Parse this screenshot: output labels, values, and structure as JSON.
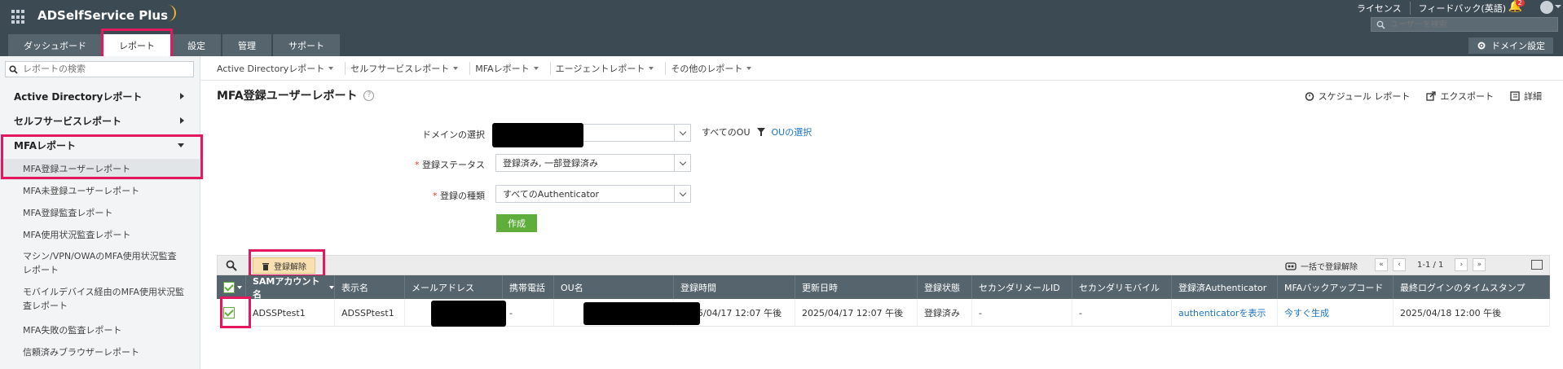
{
  "header": {
    "brand": "ADSelfService Plus",
    "links": [
      "ライセンス",
      "フィードバック(英語)"
    ],
    "notification_count": "2",
    "user_search_placeholder": "ユーザーを検索",
    "tabs": [
      "ダッシュボード",
      "レポート",
      "設定",
      "管理",
      "サポート"
    ],
    "active_tab": "レポート",
    "domain_settings": "ドメイン設定"
  },
  "sidebar": {
    "search_placeholder": "レポートの検索",
    "categories": [
      "Active Directoryレポート",
      "セルフサービスレポート",
      "MFAレポート"
    ],
    "mfa_items": [
      "MFA登録ユーザーレポート",
      "MFA未登録ユーザーレポート",
      "MFA登録監査レポート",
      "MFA使用状況監査レポート",
      "マシン/VPN/OWAのMFA使用状況監査レポート",
      "モバイルデバイス経由のMFA使用状況監査レポート",
      "MFA失敗の監査レポート",
      "信頼済みブラウザーレポート"
    ]
  },
  "report_nav": [
    "Active Directoryレポート",
    "セルフサービスレポート",
    "MFAレポート",
    "エージェントレポート",
    "その他のレポート"
  ],
  "page": {
    "title": "MFA登録ユーザーレポート",
    "actions": [
      "スケジュール レポート",
      "エクスポート",
      "詳細"
    ]
  },
  "form": {
    "domain_label": "ドメインの選択",
    "ou_all": "すべてのOU",
    "ou_select": "OUの選択",
    "status_label": "登録ステータス",
    "status_value": "登録済み, 一部登録済み",
    "type_label": "登録の種類",
    "type_value": "すべてのAuthenticator",
    "generate": "作成"
  },
  "table": {
    "unregister_label": "登録解除",
    "bulk_unregister": "一括で登録解除",
    "page_info": "1-1 / 1",
    "columns": [
      "SAMアカウント名",
      "表示名",
      "メールアドレス",
      "携帯電話",
      "OU名",
      "登録時間",
      "更新日時",
      "登録状態",
      "セカンダリメールID",
      "セカンダリモバイル",
      "登録済Authenticator",
      "MFAバックアップコード",
      "最終ログインのタイムスタンプ"
    ],
    "rows": [
      {
        "sam": "ADSSPtest1",
        "display": "ADSSPtest1",
        "mobile": "-",
        "registered": "2025/04/17 12:07 午後",
        "updated": "2025/04/17 12:07 午後",
        "status": "登録済み",
        "sec_email": "-",
        "sec_mobile": "-",
        "authenticator": "authenticatorを表示",
        "backup_code": "今すぐ生成",
        "last_login": "2025/04/18 12:00 午後"
      }
    ]
  },
  "colors": {
    "header_bg": "#3c4a54",
    "highlight": "#e4195d",
    "link": "#1a73c4",
    "generate_btn": "#5fae3c"
  }
}
